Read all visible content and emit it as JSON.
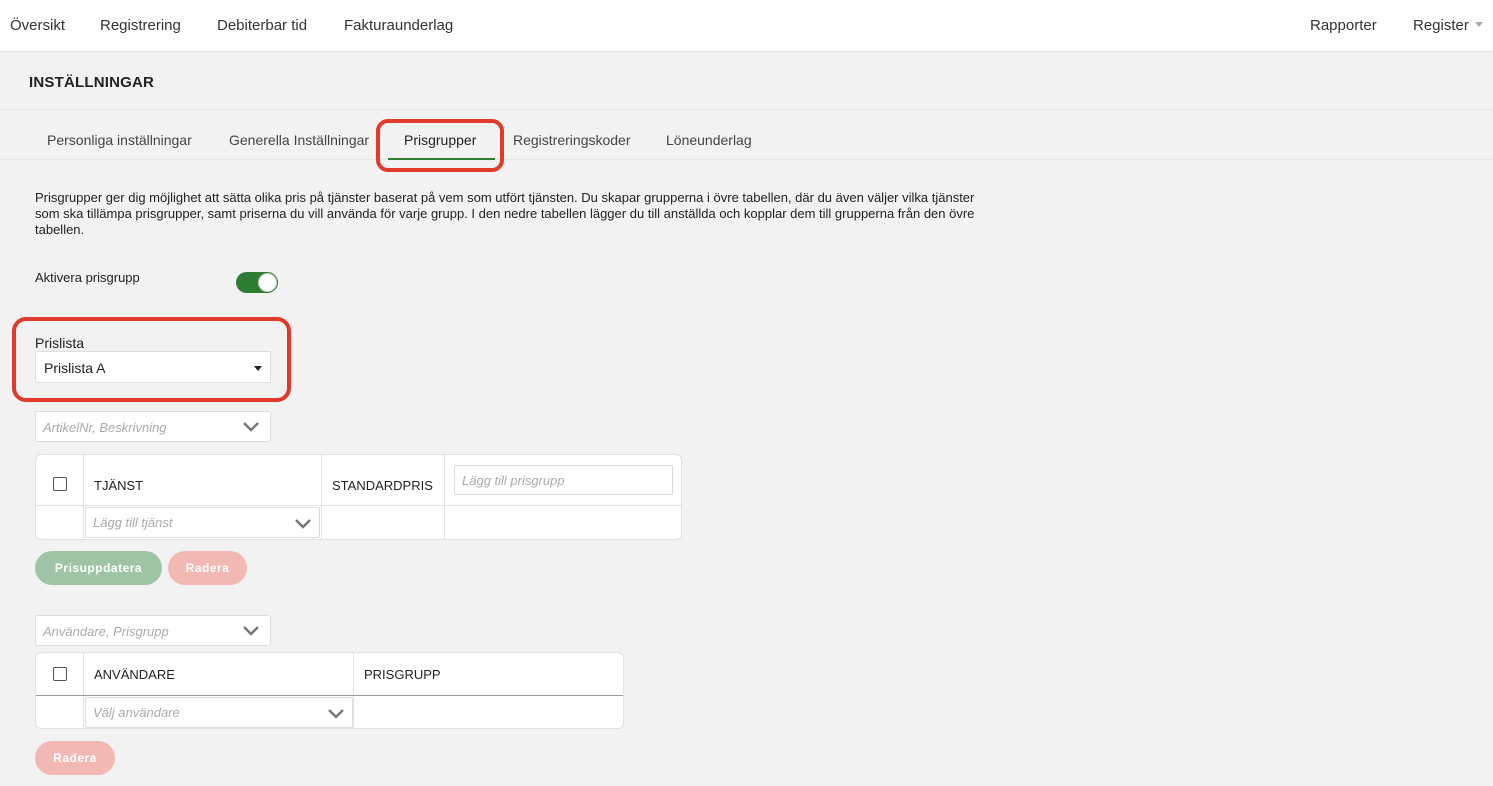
{
  "topnav": {
    "items": [
      "Översikt",
      "Registrering",
      "Debiterbar tid",
      "Fakturaunderlag"
    ],
    "right": [
      "Rapporter",
      "Register"
    ]
  },
  "page": {
    "title": "INSTÄLLNINGAR"
  },
  "tabs": [
    "Personliga inställningar",
    "Generella Inställningar",
    "Prisgrupper",
    "Registreringskoder",
    "Löneunderlag"
  ],
  "active_tab": "Prisgrupper",
  "description": "Prisgrupper ger dig möjlighet att sätta olika pris på tjänster baserat på vem som utfört tjänsten. Du skapar grupperna i övre tabellen, där du även väljer vilka tjänster som ska tillämpa prisgrupper, samt priserna du vill använda för varje grupp. I den nedre tabellen lägger du till anställda och kopplar dem till grupperna från den övre tabellen.",
  "toggle": {
    "label": "Aktivera prisgrupp",
    "on": true
  },
  "prislista": {
    "label": "Prislista",
    "selected": "Prislista A"
  },
  "services": {
    "filter_placeholder": "ArtikelNr, Beskrivning",
    "col_service": "TJÄNST",
    "col_price": "STANDARDPRIS",
    "add_group_placeholder": "Lägg till prisgrupp",
    "add_service_placeholder": "Lägg till tjänst",
    "btn_update": "Prisuppdatera",
    "btn_delete": "Radera"
  },
  "users": {
    "filter_placeholder": "Användare, Prisgrupp",
    "col_user": "ANVÄNDARE",
    "col_group": "PRISGRUPP",
    "select_user_placeholder": "Välj användare",
    "btn_delete": "Radera"
  },
  "colors": {
    "accent": "#2e7d32",
    "highlight": "#e03a2b"
  }
}
